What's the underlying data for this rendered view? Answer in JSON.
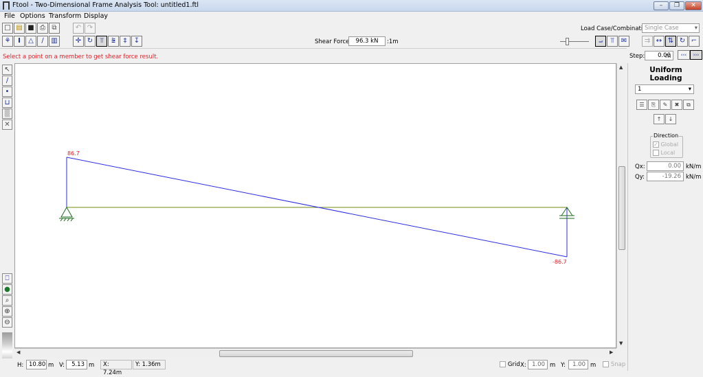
{
  "window": {
    "title": "Ftool - Two-Dimensional Frame Analysis Tool: untitled1.ftl",
    "minimize": "–",
    "restore": "❐",
    "close": "✕"
  },
  "menu": [
    "File",
    "Options",
    "Transform",
    "Display"
  ],
  "toolbar1": {
    "file_icons": [
      "new-file-icon",
      "open-folder-icon",
      "save-disk-icon",
      "print-icon",
      "copy-icon"
    ],
    "file_glyphs": [
      "□",
      "▤",
      "■",
      "⎙",
      "⧉"
    ],
    "undo_glyph": "↶",
    "redo_glyph": "↷"
  },
  "load_case": {
    "label": "Load Case/Combination:",
    "value": "Single Case"
  },
  "toolbar2": {
    "model_glyphs": [
      "⚘",
      "I",
      "△",
      "∕",
      "▥"
    ],
    "model_icons": [
      "material-icon",
      "section-icon",
      "support-icon",
      "hinge-icon",
      "frame-icon"
    ],
    "load_glyphs": [
      "✛",
      "↻",
      "⫪",
      "⩰",
      "‡",
      "↧"
    ],
    "load_icons": [
      "nodal-force-icon",
      "nodal-moment-icon",
      "uniform-load-icon",
      "linear-load-icon",
      "thermal-load-icon",
      "displacement-load-icon"
    ]
  },
  "shear_force": {
    "label": "Shear Force:",
    "value": "96.3 kN",
    "scale": ":1m"
  },
  "result_toolbar": {
    "diagram_glyphs": [
      "⨼",
      "⫪",
      "✉"
    ],
    "diagram_icons": [
      "deformed-shape-icon",
      "reactions-icon",
      "envelope-icon"
    ],
    "result_glyphs": [
      "⇉",
      "↔",
      "⇅",
      "↻",
      "⌐"
    ],
    "result_icons": [
      "axial-force-icon",
      "horizontal-arrow-icon",
      "shear-force-icon",
      "bending-moment-icon",
      "deformation-icon"
    ]
  },
  "status_message": "Select a point on a member to get shear force result.",
  "step": {
    "label": "Step:",
    "value": "0.00",
    "unit": "m"
  },
  "left_tools": {
    "top_glyphs": [
      "↖",
      "∕",
      "•",
      "⊔",
      "▒",
      "✕"
    ],
    "top_icons": [
      "select-arrow-icon",
      "line-member-icon",
      "node-point-icon",
      "dimension-icon",
      "grid-pattern-icon",
      "delete-x-icon"
    ],
    "bottom_glyphs": [
      "⎕",
      "●",
      "⌕",
      "⊕",
      "⊖"
    ],
    "bottom_icons": [
      "monitor-icon",
      "globe-icon",
      "zoom-icon",
      "zoom-in-icon",
      "zoom-out-icon"
    ]
  },
  "diagram": {
    "left_value": "86.7",
    "right_value": "-86.7",
    "beam_color": "#6f8a14",
    "diagram_color": "#2b2be6",
    "label_color": "#e0202a"
  },
  "panel": {
    "title_line1": "Uniform",
    "title_line2": "Loading",
    "selected_load": "1",
    "button_icons": [
      "new-load-icon",
      "apply-load-icon",
      "edit-load-icon",
      "delete-load-icon",
      "copy-load-icon"
    ],
    "button_glyphs": [
      "☰",
      "⎘",
      "✎",
      "✖",
      "⧉"
    ],
    "sub_buttons": [
      "↑",
      "↓"
    ],
    "direction_label": "Direction",
    "global_label": "Global",
    "local_label": "Local",
    "qx_label": "Qx:",
    "qx_value": "0.00",
    "qy_label": "Qy:",
    "qy_value": "-19.26",
    "unit": "kN/m"
  },
  "status_bar": {
    "h_label": "H:",
    "h_value": "10.80",
    "v_label": "V:",
    "v_value": "5.13",
    "unit": "m",
    "x_coord": "X: 7.24m",
    "y_coord": "Y: 1.36m",
    "grid_label": "Grid",
    "grid_x_label": "X:",
    "grid_x_value": "1.00",
    "grid_y_label": "Y:",
    "grid_y_value": "1.00",
    "snap_label": "Snap"
  }
}
